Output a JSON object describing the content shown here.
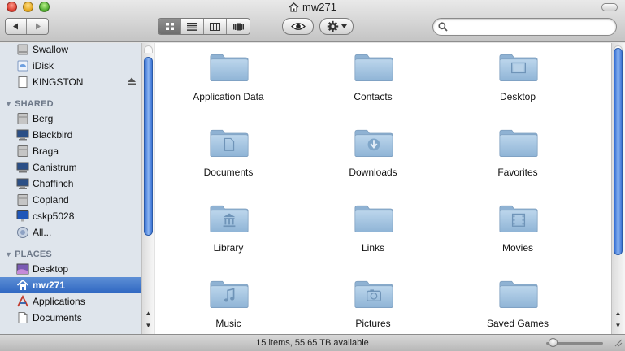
{
  "window": {
    "title": "mw271",
    "title_icon": "home-icon"
  },
  "toolbar": {
    "back_icon": "back-arrow-icon",
    "forward_icon": "forward-arrow-icon",
    "view_modes": [
      "icon-view-icon",
      "list-view-icon",
      "column-view-icon",
      "coverflow-view-icon"
    ],
    "active_view": "icon-view-icon",
    "quicklook_icon": "eye-icon",
    "action_icon": "gear-icon",
    "search": {
      "value": "",
      "placeholder": ""
    }
  },
  "sidebar": {
    "devices": [
      {
        "label": "Swallow",
        "icon": "hard-disk-icon"
      },
      {
        "label": "iDisk",
        "icon": "idisk-icon"
      },
      {
        "label": "KINGSTON",
        "icon": "usb-drive-icon",
        "eject": true
      }
    ],
    "shared_header": "SHARED",
    "shared": [
      {
        "label": "Berg",
        "icon": "server-icon"
      },
      {
        "label": "Blackbird",
        "icon": "computer-icon"
      },
      {
        "label": "Braga",
        "icon": "server-icon"
      },
      {
        "label": "Canistrum",
        "icon": "computer-icon"
      },
      {
        "label": "Chaffinch",
        "icon": "computer-icon"
      },
      {
        "label": "Copland",
        "icon": "server-icon"
      },
      {
        "label": "cskp5028",
        "icon": "imac-icon"
      },
      {
        "label": "All...",
        "icon": "network-icon"
      }
    ],
    "places_header": "PLACES",
    "places": [
      {
        "label": "Desktop",
        "icon": "desktop-icon"
      },
      {
        "label": "mw271",
        "icon": "home-icon",
        "selected": true
      },
      {
        "label": "Applications",
        "icon": "applications-icon"
      },
      {
        "label": "Documents",
        "icon": "documents-icon"
      }
    ]
  },
  "files": [
    {
      "name": "Application Data",
      "icon": "folder-icon"
    },
    {
      "name": "Contacts",
      "icon": "folder-icon"
    },
    {
      "name": "Desktop",
      "icon": "desktop-folder-icon"
    },
    {
      "name": "Documents",
      "icon": "documents-folder-icon"
    },
    {
      "name": "Downloads",
      "icon": "downloads-folder-icon"
    },
    {
      "name": "Favorites",
      "icon": "folder-icon"
    },
    {
      "name": "Library",
      "icon": "library-folder-icon"
    },
    {
      "name": "Links",
      "icon": "folder-icon"
    },
    {
      "name": "Movies",
      "icon": "movies-folder-icon"
    },
    {
      "name": "Music",
      "icon": "music-folder-icon"
    },
    {
      "name": "Pictures",
      "icon": "pictures-folder-icon"
    },
    {
      "name": "Saved Games",
      "icon": "folder-icon"
    }
  ],
  "status": {
    "text": "15 items, 55.65 TB available"
  },
  "colors": {
    "selection": "#3a72c9",
    "folder": "#9fc0dc",
    "scroll_thumb": "#3c74d4"
  }
}
